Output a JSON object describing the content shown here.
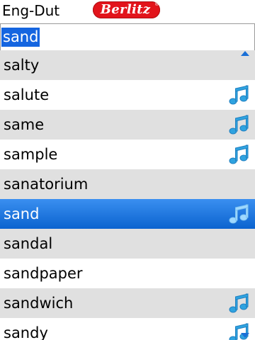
{
  "header": {
    "title": "Eng-Dut",
    "logo_text": "Berlitz",
    "logo_mark": "®"
  },
  "search": {
    "value": "sand"
  },
  "icons": {
    "audio": "music-note-icon",
    "scroll_up": "scroll-up-arrow-icon",
    "scroll_down": "scroll-down-arrow-icon"
  },
  "colors": {
    "selection": "#1565e0",
    "audio": "#2fa3e0",
    "brand": "#e2141b"
  },
  "list": {
    "items": [
      {
        "word": "salty",
        "audio": false,
        "style": "alt"
      },
      {
        "word": "salute",
        "audio": true,
        "style": "white"
      },
      {
        "word": "same",
        "audio": true,
        "style": "alt"
      },
      {
        "word": "sample",
        "audio": true,
        "style": "white"
      },
      {
        "word": "sanatorium",
        "audio": false,
        "style": "alt"
      },
      {
        "word": "sand",
        "audio": true,
        "style": "selected"
      },
      {
        "word": "sandal",
        "audio": false,
        "style": "alt"
      },
      {
        "word": "sandpaper",
        "audio": false,
        "style": "white"
      },
      {
        "word": "sandwich",
        "audio": true,
        "style": "alt"
      },
      {
        "word": "sandy",
        "audio": true,
        "style": "white"
      }
    ]
  }
}
